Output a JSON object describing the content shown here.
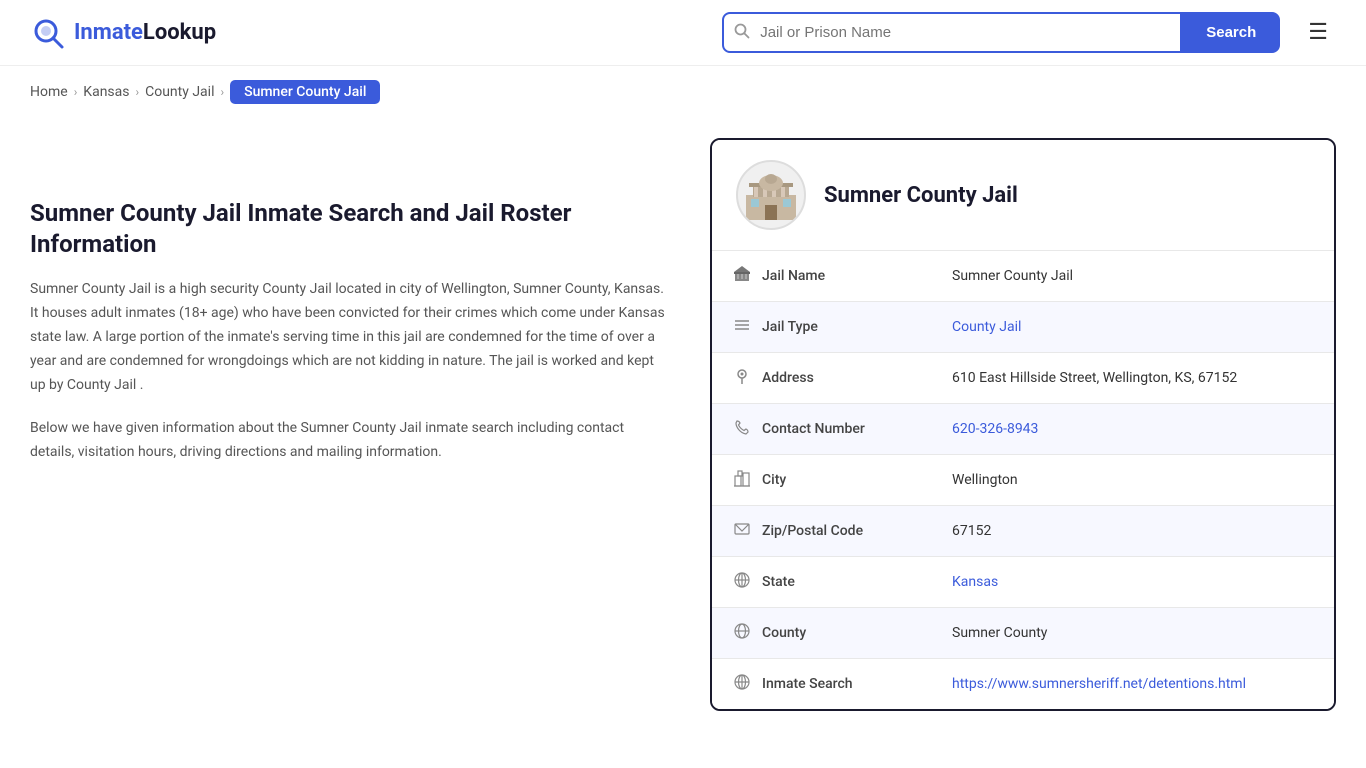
{
  "header": {
    "logo_text_blue": "Inmate",
    "logo_text_dark": "Lookup",
    "search_placeholder": "Jail or Prison Name",
    "search_button": "Search",
    "menu_icon": "☰"
  },
  "breadcrumb": {
    "items": [
      {
        "label": "Home",
        "href": "#"
      },
      {
        "label": "Kansas",
        "href": "#"
      },
      {
        "label": "County Jail",
        "href": "#"
      }
    ],
    "current": "Sumner County Jail"
  },
  "left": {
    "title": "Sumner County Jail Inmate Search and Jail Roster Information",
    "description1": "Sumner County Jail is a high security County Jail located in city of Wellington, Sumner County, Kansas. It houses adult inmates (18+ age) who have been convicted for their crimes which come under Kansas state law. A large portion of the inmate's serving time in this jail are condemned for the time of over a year and are condemned for wrongdoings which are not kidding in nature. The jail is worked and kept up by County Jail .",
    "description2": "Below we have given information about the Sumner County Jail inmate search including contact details, visitation hours, driving directions and mailing information."
  },
  "card": {
    "title": "Sumner County Jail",
    "fields": [
      {
        "icon": "🏛",
        "label": "Jail Name",
        "value": "Sumner County Jail",
        "link": null
      },
      {
        "icon": "≡",
        "label": "Jail Type",
        "value": "County Jail",
        "link": "#"
      },
      {
        "icon": "📍",
        "label": "Address",
        "value": "610 East Hillside Street, Wellington, KS, 67152",
        "link": null
      },
      {
        "icon": "📞",
        "label": "Contact Number",
        "value": "620-326-8943",
        "link": "tel:620-326-8943"
      },
      {
        "icon": "🏙",
        "label": "City",
        "value": "Wellington",
        "link": null
      },
      {
        "icon": "✉",
        "label": "Zip/Postal Code",
        "value": "67152",
        "link": null
      },
      {
        "icon": "🌐",
        "label": "State",
        "value": "Kansas",
        "link": "#"
      },
      {
        "icon": "🗺",
        "label": "County",
        "value": "Sumner County",
        "link": null
      },
      {
        "icon": "🌐",
        "label": "Inmate Search",
        "value": "https://www.sumnersheriff.net/detentions.html",
        "link": "https://www.sumnersheriff.net/detentions.html"
      }
    ]
  }
}
